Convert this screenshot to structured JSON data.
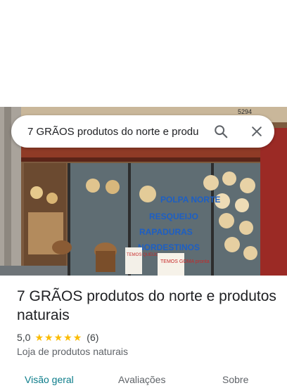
{
  "search": {
    "query": "7 GRÃOS produtos do norte e produ",
    "search_icon": "search-icon",
    "close_icon": "close-icon"
  },
  "place": {
    "name": "7 GRÃOS produtos do norte e produtos naturais",
    "rating": "5,0",
    "stars": 5,
    "reviews": "(6)",
    "category": "Loja de produtos naturais"
  },
  "photo_signs": {
    "store_number": "5294",
    "window_line1": "POLPA NORTE",
    "window_line2": "RESQUEIJO",
    "window_line3": "RAPADURAS",
    "window_line4": "NORDESTINOS",
    "sign_temos_queijo": "TEMOS QUEIJO",
    "sign_goma": "TEMOS GOMA pronta"
  },
  "tabs": [
    {
      "label": "Visão geral",
      "active": true
    },
    {
      "label": "Avaliações",
      "active": false
    },
    {
      "label": "Sobre",
      "active": false
    }
  ],
  "colors": {
    "star": "#fbbc04",
    "active_tab": "#0b7c8a"
  }
}
